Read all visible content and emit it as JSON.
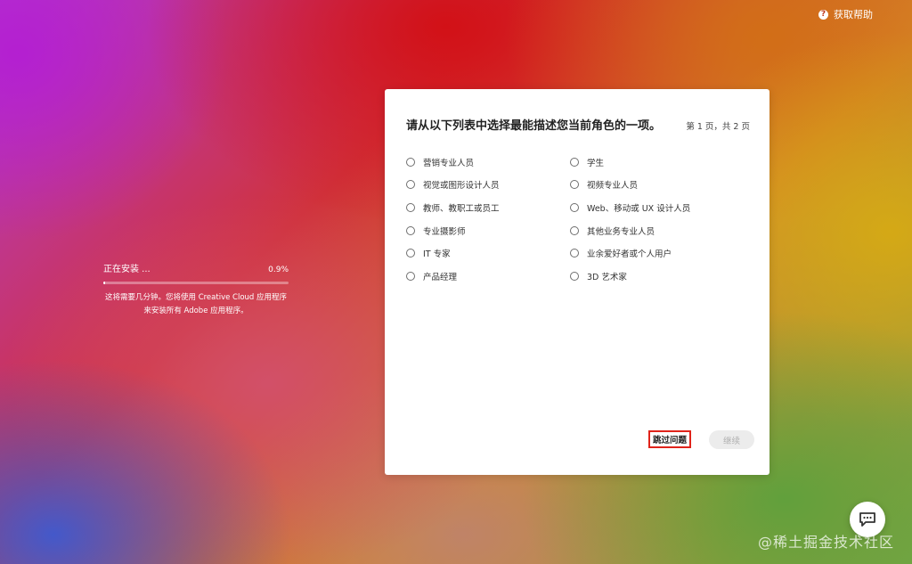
{
  "help": {
    "icon": "help-circle-icon",
    "label": "获取帮助"
  },
  "install": {
    "label": "正在安装 ...",
    "percent_text": "0.9%",
    "progress_fraction": 0.009,
    "note": "这将需要几分钟。您将使用 Creative Cloud 应用程序来安装所有 Adobe 应用程序。"
  },
  "dialog": {
    "title": "请从以下列表中选择最能描述您当前角色的一项。",
    "page_indicator": "第 1 页，共 2 页",
    "options_left": [
      "营销专业人员",
      "视觉或图形设计人员",
      "教师、教职工或员工",
      "专业摄影师",
      "IT 专家",
      "产品经理"
    ],
    "options_right": [
      "学生",
      "视频专业人员",
      "Web、移动或 UX 设计人员",
      "其他业务专业人员",
      "业余爱好者或个人用户",
      "3D 艺术家"
    ],
    "skip_label": "跳过问题",
    "continue_label": "继续"
  },
  "chat": {
    "icon": "chat-bubble-icon"
  },
  "watermark": {
    "text": "@稀土掘金技术社区"
  },
  "colors": {
    "highlight_border": "#e0231a",
    "card_bg": "#ffffff",
    "continue_disabled_bg": "#ececec"
  }
}
